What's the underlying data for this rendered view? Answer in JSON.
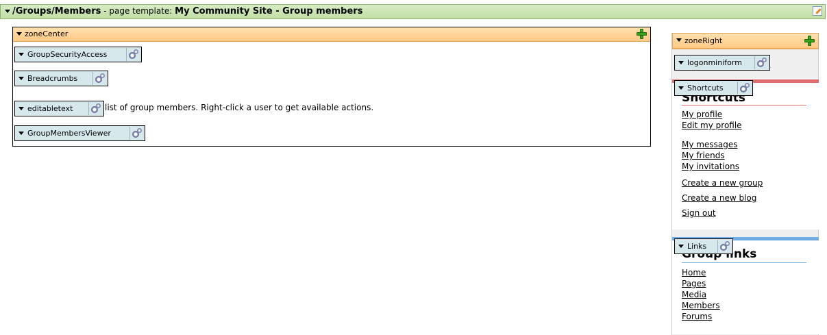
{
  "page_bar": {
    "path": "/Groups/Members",
    "template_label": " - page template: ",
    "template_name": "My Community Site - Group members"
  },
  "zone_center": {
    "title": "zoneCenter",
    "webparts": [
      "GroupSecurityAccess",
      "Breadcrumbs",
      "editabletext",
      "GroupMembersViewer"
    ],
    "edit_text": "list of group members. Right-click a user to get available actions."
  },
  "zone_right": {
    "title": "zoneRight",
    "webparts": [
      "logonminiform",
      "Shortcuts",
      "Links"
    ],
    "shortcuts": {
      "title": "Shortcuts",
      "links_group1": [
        "My profile",
        "Edit my profile"
      ],
      "links_group2": [
        "My messages",
        "My friends",
        "My invitations"
      ],
      "links_group3": [
        "Create a new group",
        "Create a new blog",
        "Sign out"
      ]
    },
    "group_links": {
      "title": "Group links",
      "links": [
        "Home",
        "Pages",
        "Media",
        "Members",
        "Forums"
      ]
    }
  }
}
